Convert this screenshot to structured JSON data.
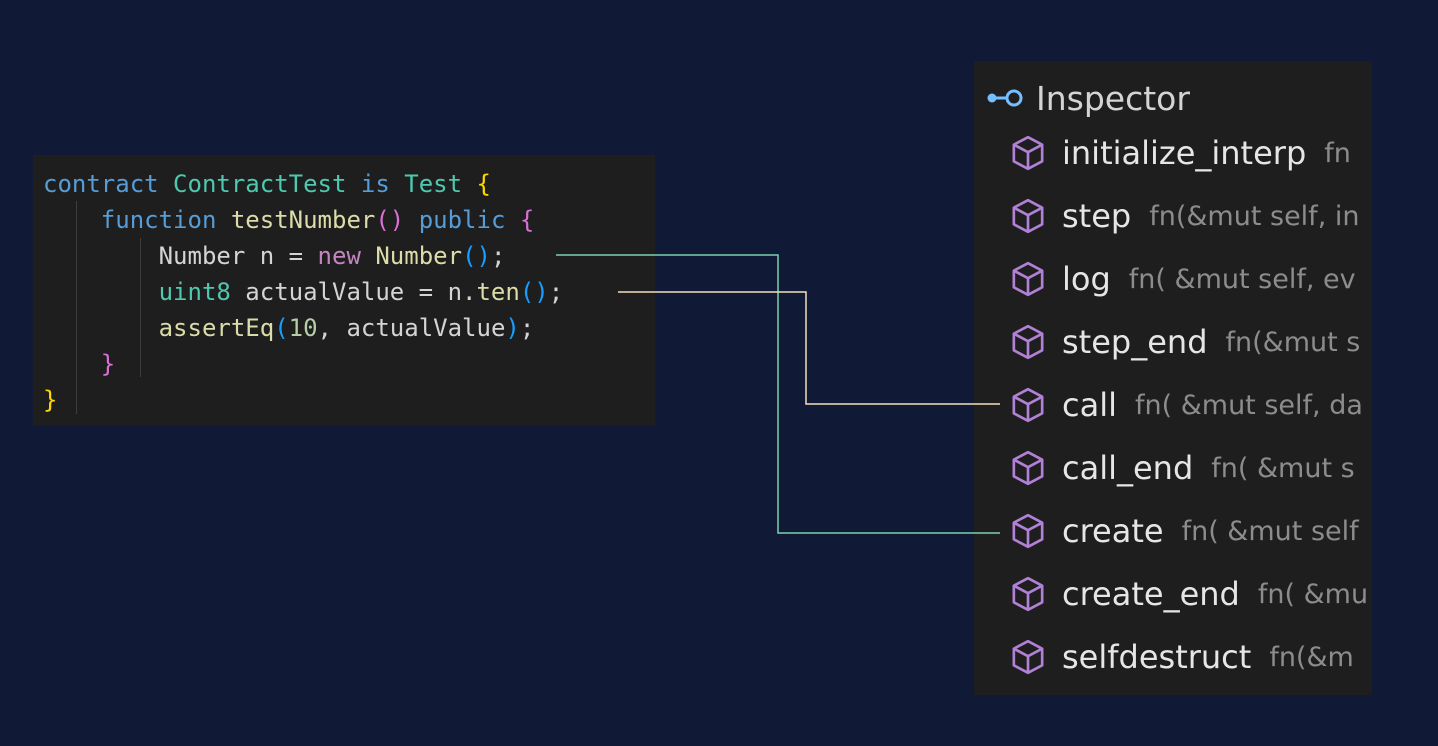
{
  "code": {
    "lines": [
      [
        {
          "t": "contract",
          "c": "kw"
        },
        {
          "t": " ",
          "c": "plain"
        },
        {
          "t": "ContractTest",
          "c": "ty"
        },
        {
          "t": " ",
          "c": "plain"
        },
        {
          "t": "is",
          "c": "kw"
        },
        {
          "t": " ",
          "c": "plain"
        },
        {
          "t": "Test",
          "c": "ty"
        },
        {
          "t": " ",
          "c": "plain"
        },
        {
          "t": "{",
          "c": "pa1"
        }
      ],
      [
        {
          "t": "    ",
          "c": "plain"
        },
        {
          "t": "function",
          "c": "kw"
        },
        {
          "t": " ",
          "c": "plain"
        },
        {
          "t": "testNumber",
          "c": "fnname"
        },
        {
          "t": "()",
          "c": "pa2"
        },
        {
          "t": " ",
          "c": "plain"
        },
        {
          "t": "public",
          "c": "kw"
        },
        {
          "t": " ",
          "c": "plain"
        },
        {
          "t": "{",
          "c": "pa2"
        }
      ],
      [
        {
          "t": "        ",
          "c": "plain"
        },
        {
          "t": "Number n = ",
          "c": "plain"
        },
        {
          "t": "new",
          "c": "kw2"
        },
        {
          "t": " ",
          "c": "plain"
        },
        {
          "t": "Number",
          "c": "fnname"
        },
        {
          "t": "()",
          "c": "pa3"
        },
        {
          "t": ";",
          "c": "plain"
        }
      ],
      [
        {
          "t": "        ",
          "c": "plain"
        },
        {
          "t": "uint8",
          "c": "ty"
        },
        {
          "t": " actualValue = n.",
          "c": "plain"
        },
        {
          "t": "ten",
          "c": "fnname"
        },
        {
          "t": "()",
          "c": "pa3"
        },
        {
          "t": ";",
          "c": "plain"
        }
      ],
      [
        {
          "t": "        ",
          "c": "plain"
        },
        {
          "t": "assertEq",
          "c": "fnname"
        },
        {
          "t": "(",
          "c": "pa3"
        },
        {
          "t": "10",
          "c": "num"
        },
        {
          "t": ", actualValue",
          "c": "plain"
        },
        {
          "t": ")",
          "c": "pa3"
        },
        {
          "t": ";",
          "c": "plain"
        }
      ],
      [
        {
          "t": "    ",
          "c": "plain"
        },
        {
          "t": "}",
          "c": "pa2"
        }
      ],
      [
        {
          "t": "}",
          "c": "pa1"
        }
      ]
    ]
  },
  "inspector": {
    "title": "Inspector",
    "icon": "interface-icon",
    "members": [
      {
        "name": "initialize_interp",
        "signature": "fn",
        "icon": "method-cube-icon"
      },
      {
        "name": "step",
        "signature": "fn(&mut self, in",
        "icon": "method-cube-icon"
      },
      {
        "name": "log",
        "signature": "fn( &mut self, ev",
        "icon": "method-cube-icon"
      },
      {
        "name": "step_end",
        "signature": "fn(&mut s",
        "icon": "method-cube-icon"
      },
      {
        "name": "call",
        "signature": "fn( &mut self, da",
        "icon": "method-cube-icon"
      },
      {
        "name": "call_end",
        "signature": "fn( &mut s",
        "icon": "method-cube-icon"
      },
      {
        "name": "create",
        "signature": "fn( &mut self",
        "icon": "method-cube-icon"
      },
      {
        "name": "create_end",
        "signature": "fn( &mu",
        "icon": "method-cube-icon"
      },
      {
        "name": "selfdestruct",
        "signature": "fn(&m",
        "icon": "method-cube-icon"
      }
    ]
  },
  "connectors": [
    {
      "from": "Number()",
      "to": "create",
      "color": "#7ad1ad"
    },
    {
      "from": "n.ten()",
      "to": "call",
      "color": "#f4dfb8"
    }
  ],
  "colors": {
    "background": "#101a37",
    "panel": "#1e1e1e",
    "method_icon": "#b180d7",
    "interface_icon": "#75beff"
  }
}
